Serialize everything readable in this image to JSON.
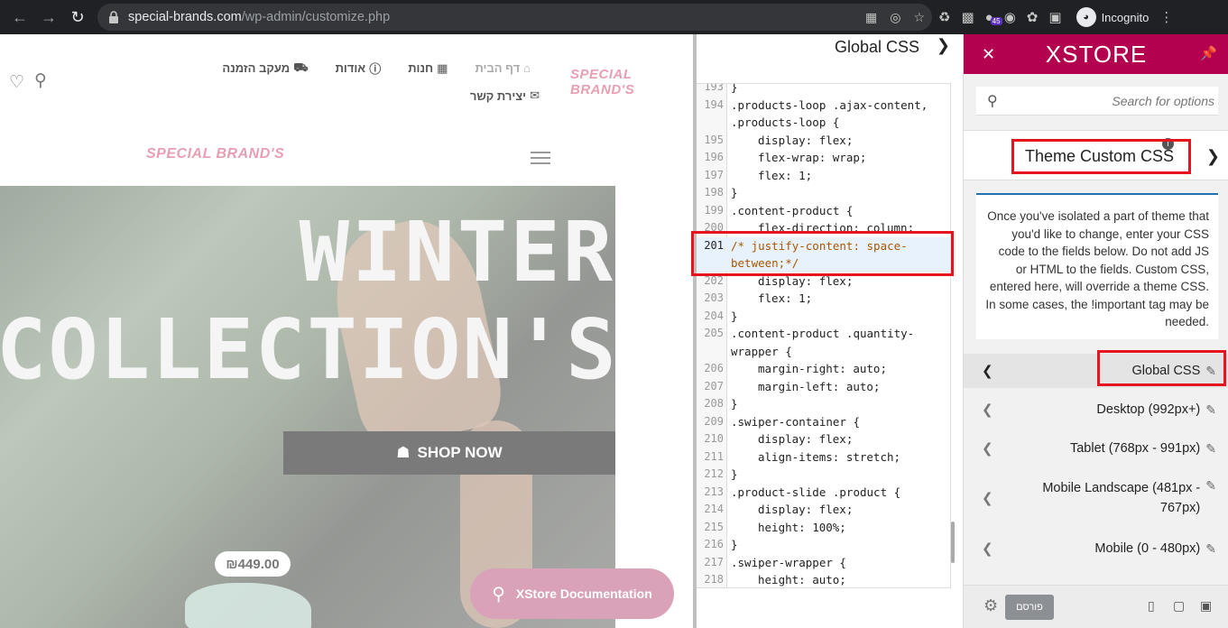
{
  "browser": {
    "url_host": "special-brands.com",
    "url_path": "/wp-admin/customize.php",
    "extension_badge": "45",
    "profile_label": "Incognito"
  },
  "site": {
    "menu_home": "דף הבית",
    "menu_shop": "חנות",
    "menu_about": "אודות",
    "menu_tracking": "מעקב הזמנה",
    "menu_contact": "יצירת קשר",
    "logo_text": "SPECIAL BRAND'S",
    "hero_line1": "WINTER",
    "hero_line2": "COLLECTION'S",
    "shop_button": "SHOP NOW",
    "price": "₪449.00",
    "doc_button": "XStore Documentation"
  },
  "code_panel": {
    "title": "Global CSS",
    "lines": [
      {
        "n": "193",
        "t": "}",
        "i": false,
        "hl": false
      },
      {
        "n": "194",
        "t": ".products-loop .ajax-content,",
        "i": false,
        "hl": false
      },
      {
        "n": "",
        "t": ".products-loop {",
        "i": false,
        "hl": false
      },
      {
        "n": "195",
        "t": "display: flex;",
        "i": true,
        "hl": false
      },
      {
        "n": "196",
        "t": "flex-wrap: wrap;",
        "i": true,
        "hl": false
      },
      {
        "n": "197",
        "t": "flex: 1;",
        "i": true,
        "hl": false
      },
      {
        "n": "198",
        "t": "}",
        "i": false,
        "hl": false
      },
      {
        "n": "199",
        "t": ".content-product {",
        "i": false,
        "hl": false
      },
      {
        "n": "200",
        "t": "flex-direction: column;",
        "i": true,
        "hl": false
      },
      {
        "n": "201",
        "t": " /*   justify-content: space-",
        "i": false,
        "hl": true
      },
      {
        "n": "",
        "t": "between;*/",
        "i": false,
        "hl": true
      },
      {
        "n": "202",
        "t": "display: flex;",
        "i": true,
        "hl": false
      },
      {
        "n": "203",
        "t": "flex: 1;",
        "i": true,
        "hl": false
      },
      {
        "n": "204",
        "t": "}",
        "i": false,
        "hl": false
      },
      {
        "n": "205",
        "t": ".content-product .quantity-",
        "i": false,
        "hl": false
      },
      {
        "n": "",
        "t": "wrapper {",
        "i": false,
        "hl": false
      },
      {
        "n": "206",
        "t": "margin-right: auto;",
        "i": true,
        "hl": false
      },
      {
        "n": "207",
        "t": "margin-left: auto;",
        "i": true,
        "hl": false
      },
      {
        "n": "208",
        "t": "}",
        "i": false,
        "hl": false
      },
      {
        "n": "209",
        "t": ".swiper-container {",
        "i": false,
        "hl": false
      },
      {
        "n": "210",
        "t": "display: flex;",
        "i": true,
        "hl": false
      },
      {
        "n": "211",
        "t": "align-items: stretch;",
        "i": true,
        "hl": false
      },
      {
        "n": "212",
        "t": "}",
        "i": false,
        "hl": false
      },
      {
        "n": "213",
        "t": ".product-slide .product {",
        "i": false,
        "hl": false
      },
      {
        "n": "214",
        "t": "display: flex;",
        "i": true,
        "hl": false
      },
      {
        "n": "215",
        "t": "height: 100%;",
        "i": true,
        "hl": false
      },
      {
        "n": "216",
        "t": "}",
        "i": false,
        "hl": false
      },
      {
        "n": "217",
        "t": ".swiper-wrapper {",
        "i": false,
        "hl": false
      },
      {
        "n": "218",
        "t": "height: auto;",
        "i": true,
        "hl": false
      }
    ]
  },
  "sidebar": {
    "brand": "XSTORE",
    "search_placeholder": "Search for options",
    "section_title": "Theme Custom CSS",
    "description": "Once you've isolated a part of theme that you'd like to change, enter your CSS code to the fields below. Do not add JS or HTML to the fields. Custom CSS, entered here, will override a theme CSS. In some cases, the !important tag may be needed.",
    "items": [
      {
        "label": "Global CSS"
      },
      {
        "label": "Desktop (992px+)"
      },
      {
        "label": "Tablet (768px - 991px)"
      },
      {
        "label": "Mobile Landscape (481px - 767px)"
      },
      {
        "label": "Mobile (0 - 480px)"
      }
    ],
    "publish_label": "פורסם"
  },
  "colors": {
    "brand": "#b3004f",
    "annotation": "#e5141e",
    "accent_pink": "#d9a2b8"
  }
}
